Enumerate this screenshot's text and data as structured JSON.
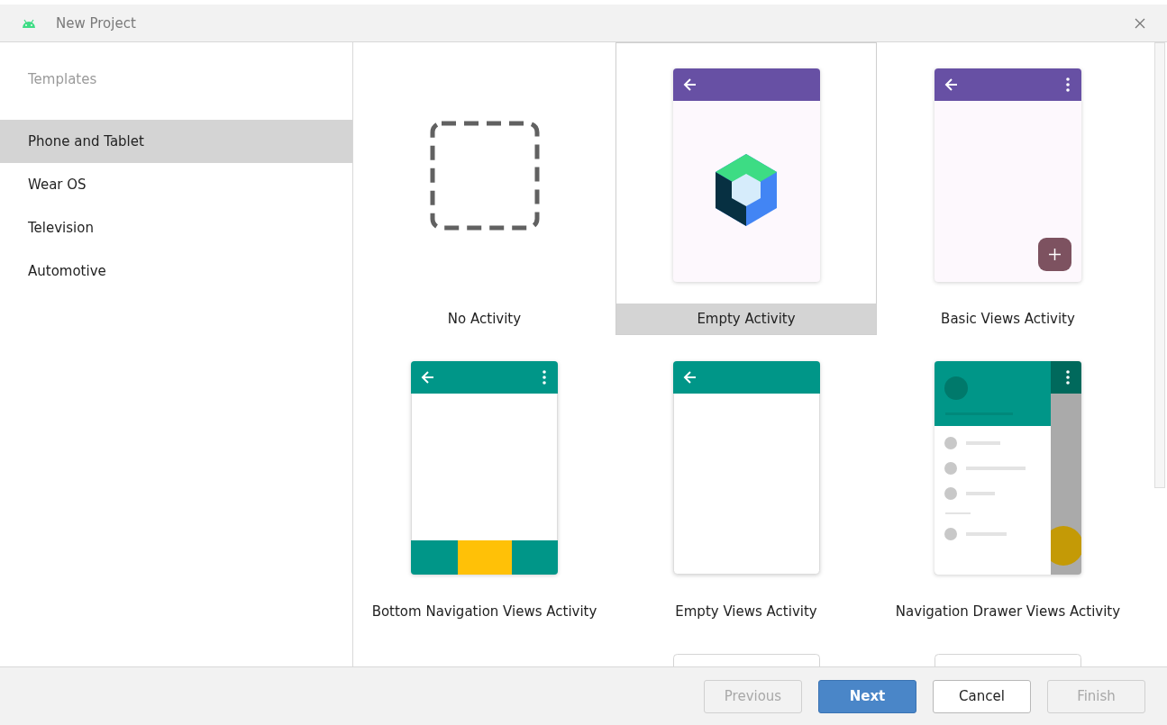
{
  "window": {
    "title": "New Project"
  },
  "sidebar": {
    "heading": "Templates",
    "items": [
      {
        "label": "Phone and Tablet",
        "selected": true
      },
      {
        "label": "Wear OS",
        "selected": false
      },
      {
        "label": "Television",
        "selected": false
      },
      {
        "label": "Automotive",
        "selected": false
      }
    ]
  },
  "templates": [
    {
      "kind": "none",
      "label": "No Activity",
      "selected": false
    },
    {
      "kind": "compose",
      "label": "Empty Activity",
      "selected": true
    },
    {
      "kind": "basic",
      "label": "Basic Views Activity",
      "selected": false
    },
    {
      "kind": "bottom_nav",
      "label": "Bottom Navigation Views Activity",
      "selected": false
    },
    {
      "kind": "empty_views",
      "label": "Empty Views Activity",
      "selected": false
    },
    {
      "kind": "drawer",
      "label": "Navigation Drawer Views Activity",
      "selected": false
    },
    {
      "kind": "plain",
      "selected": false
    },
    {
      "kind": "plain",
      "selected": false
    }
  ],
  "buttons": [
    {
      "label": "Previous",
      "primary": false,
      "disabled": true
    },
    {
      "label": "Next",
      "primary": true,
      "disabled": false
    },
    {
      "label": "Cancel",
      "primary": false,
      "disabled": false
    },
    {
      "label": "Finish",
      "primary": false,
      "disabled": true
    }
  ]
}
